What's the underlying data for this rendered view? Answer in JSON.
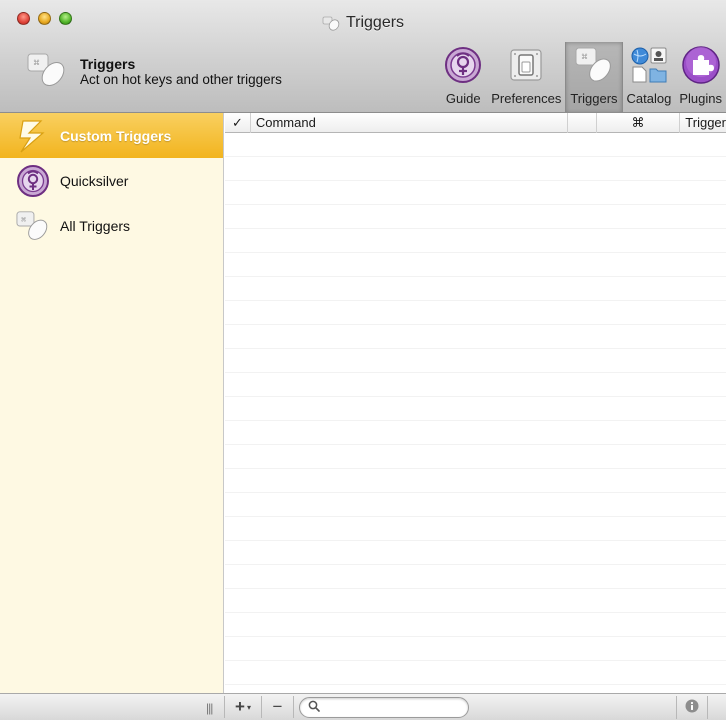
{
  "window": {
    "title": "Triggers"
  },
  "header": {
    "title": "Triggers",
    "description": "Act on hot keys and other triggers"
  },
  "toolbar": {
    "items": [
      {
        "label": "Guide",
        "icon": "quicksilver-guide-icon"
      },
      {
        "label": "Preferences",
        "icon": "preferences-switch-icon"
      },
      {
        "label": "Triggers",
        "icon": "mouse-icon",
        "active": true
      },
      {
        "label": "Catalog",
        "icon": "catalog-icon"
      },
      {
        "label": "Plugins",
        "icon": "puzzle-plugin-icon"
      }
    ]
  },
  "sidebar": {
    "items": [
      {
        "label": "Custom Triggers",
        "icon": "lightning-icon",
        "selected": true
      },
      {
        "label": "Quicksilver",
        "icon": "quicksilver-icon"
      },
      {
        "label": "All Triggers",
        "icon": "mouse-icon"
      }
    ]
  },
  "table": {
    "columns": {
      "check": "✓",
      "command": "Command",
      "modifier": "⌘",
      "trigger": "Trigger"
    },
    "rows": []
  },
  "bottombar": {
    "resize": "|||",
    "add": "+",
    "add_caret": "▾",
    "remove": "−",
    "search_placeholder": ""
  },
  "colors": {
    "sidebar_bg": "#fef9e3",
    "selection": "#f2b41e",
    "quicksilver_purple": "#8e3fa0"
  }
}
